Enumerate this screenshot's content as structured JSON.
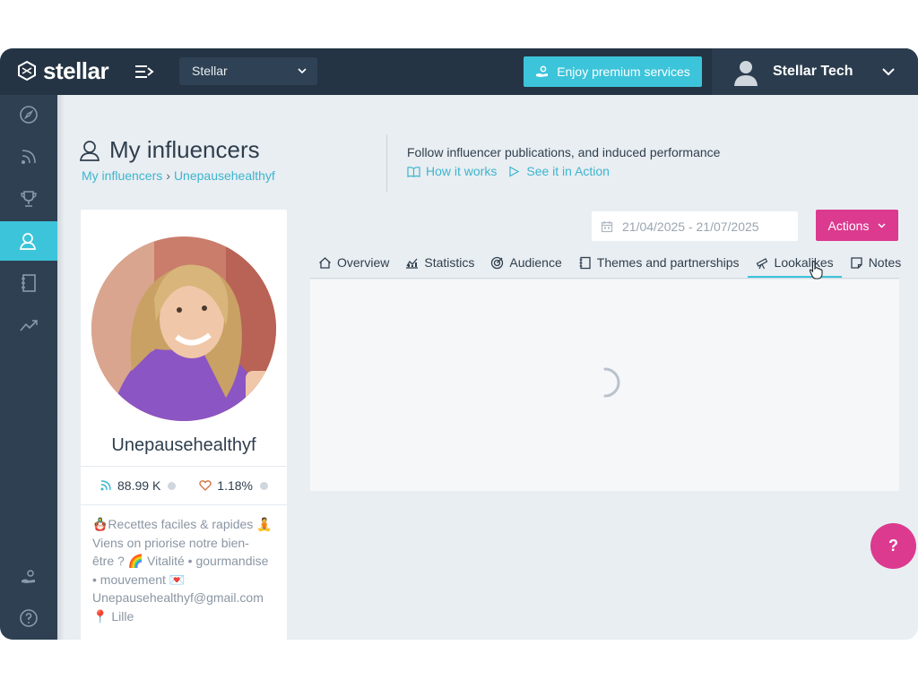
{
  "topbar": {
    "brand": "stellar",
    "workspace": "Stellar",
    "premium_label": "Enjoy premium services",
    "user_name": "Stellar Tech"
  },
  "sidebar": {
    "items": [
      {
        "icon": "compass-icon",
        "active": false
      },
      {
        "icon": "feed-icon",
        "active": false
      },
      {
        "icon": "trophy-icon",
        "active": false
      },
      {
        "icon": "user-icon",
        "active": true
      },
      {
        "icon": "notebook-icon",
        "active": false
      },
      {
        "icon": "trend-icon",
        "active": false
      }
    ],
    "bottom_items": [
      {
        "icon": "premium-hand-icon"
      },
      {
        "icon": "help-circle-icon"
      }
    ]
  },
  "header": {
    "title": "My influencers",
    "breadcrumb": [
      "My influencers",
      "Unepausehealthyf"
    ],
    "description": "Follow influencer publications, and induced performance",
    "links": [
      "How it works",
      "See it in Action"
    ]
  },
  "profile": {
    "name": "Unepausehealthyf",
    "followers": "88.99 K",
    "engagement": "1.18%",
    "bio_lines": [
      "🪆Recettes faciles & rapides 🧘",
      "Viens on priorise notre bien-",
      "être ? 🌈 Vitalité • gourmandise",
      "• mouvement 💌",
      "Unepausehealthyf@gmail.com",
      "📍 Lille"
    ]
  },
  "toolbar": {
    "date_range": "21/04/2025 - 21/07/2025",
    "actions_label": "Actions"
  },
  "tabs": [
    {
      "label": "Overview",
      "icon": "home-icon",
      "active": false
    },
    {
      "label": "Statistics",
      "icon": "chart-icon",
      "active": false
    },
    {
      "label": "Audience",
      "icon": "target-icon",
      "active": false
    },
    {
      "label": "Themes and partnerships",
      "icon": "book-icon",
      "active": false
    },
    {
      "label": "Lookalikes",
      "icon": "telescope-icon",
      "active": true
    },
    {
      "label": "Notes",
      "icon": "note-icon",
      "active": false
    }
  ],
  "help_fab": "?",
  "colors": {
    "topbar": "#243444",
    "sidebar": "#2e4052",
    "accent": "#3cc4da",
    "actions": "#db3a8f",
    "link": "#3cb5cf"
  }
}
